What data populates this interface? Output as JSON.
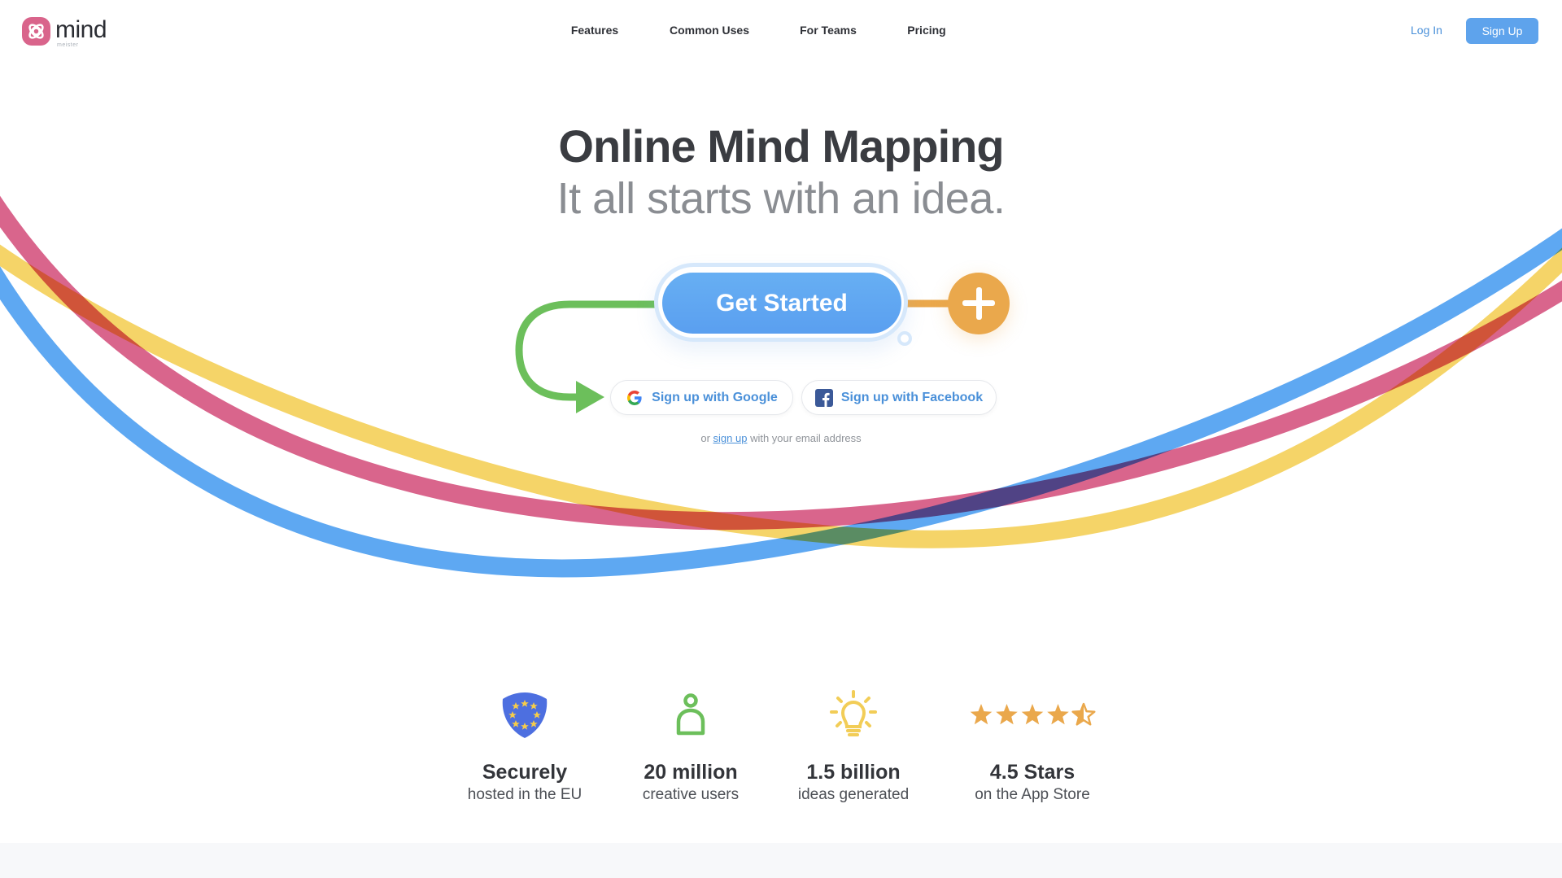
{
  "brand": {
    "name": "mind",
    "sub": "meister",
    "color": "#d9648b"
  },
  "nav": {
    "items": [
      {
        "label": "Features"
      },
      {
        "label": "Common Uses"
      },
      {
        "label": "For Teams"
      },
      {
        "label": "Pricing"
      }
    ],
    "login_label": "Log In",
    "signup_label": "Sign Up"
  },
  "hero": {
    "title": "Online Mind Mapping",
    "subtitle": "It all starts with an idea.",
    "cta_label": "Get Started",
    "plus_icon": "plus-icon",
    "google_label": "Sign up with Google",
    "facebook_label": "Sign up with Facebook",
    "email_prefix": "or ",
    "email_link": "sign up",
    "email_suffix": " with your email address"
  },
  "stats": [
    {
      "icon": "eu-shield-icon",
      "title": "Securely",
      "sub": "hosted in the EU"
    },
    {
      "icon": "user-icon",
      "title": "20 million",
      "sub": "creative users"
    },
    {
      "icon": "lightbulb-icon",
      "title": "1.5 billion",
      "sub": "ideas generated"
    },
    {
      "icon": "star-rating-icon",
      "title": "4.5 Stars",
      "sub": "on the App Store",
      "rating": 4.5,
      "rating_max": 5
    }
  ],
  "colors": {
    "accent_blue": "#5ea3ec",
    "curve_blue": "#5ea8f2",
    "curve_pink": "#d9658c",
    "curve_yellow": "#f5d468",
    "arrow_green": "#6cbf5b",
    "plus_orange": "#eaa84c",
    "star_gold": "#eaa84c"
  }
}
